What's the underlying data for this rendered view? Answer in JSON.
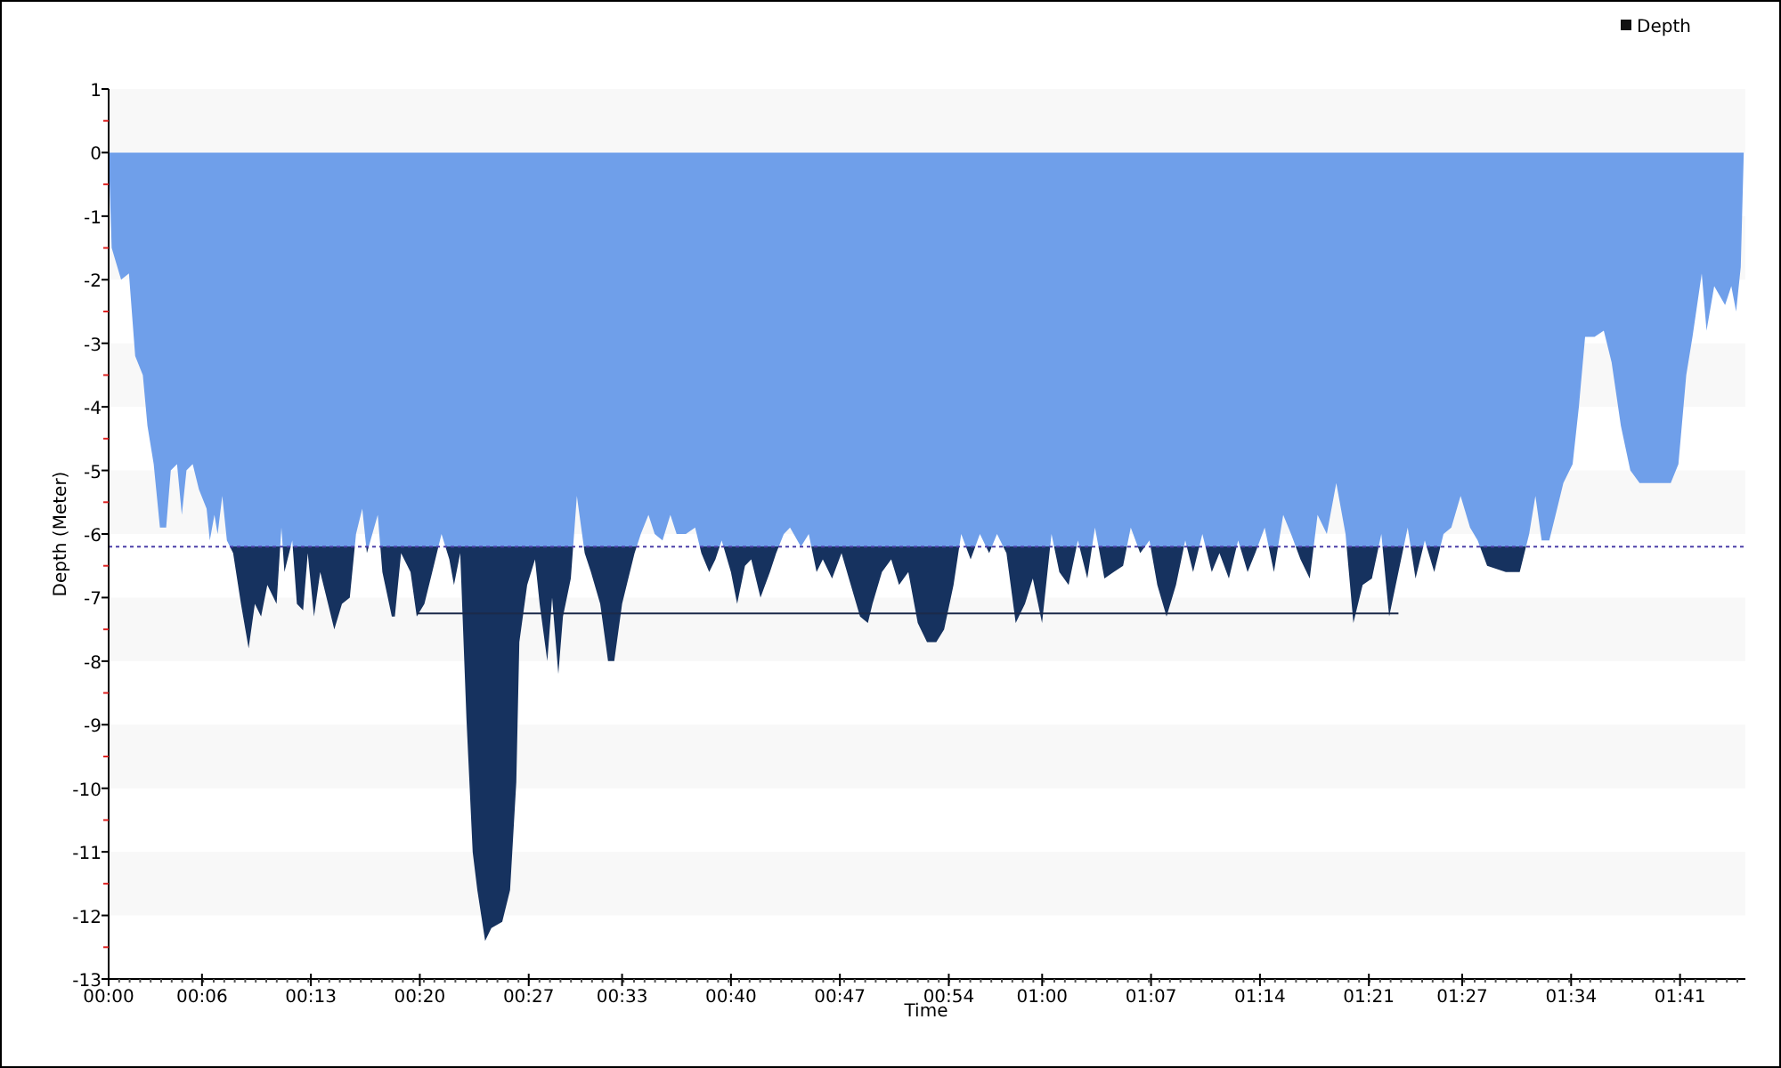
{
  "chart_data": {
    "type": "area",
    "xlabel": "Time",
    "ylabel": "Depth (Meter)",
    "xlim": [
      0,
      105.2
    ],
    "ylim": [
      -13,
      1
    ],
    "yticks": [
      1,
      0,
      -1,
      -2,
      -3,
      -4,
      -5,
      -6,
      -7,
      -8,
      -9,
      -10,
      -11,
      -12,
      -13
    ],
    "xticks": [
      {
        "value": 0,
        "label": "00:00"
      },
      {
        "value": 6,
        "label": "00:06"
      },
      {
        "value": 13,
        "label": "00:13"
      },
      {
        "value": 20,
        "label": "00:20"
      },
      {
        "value": 27,
        "label": "00:27"
      },
      {
        "value": 33,
        "label": "00:33"
      },
      {
        "value": 40,
        "label": "00:40"
      },
      {
        "value": 47,
        "label": "00:47"
      },
      {
        "value": 54,
        "label": "00:54"
      },
      {
        "value": 60,
        "label": "01:00"
      },
      {
        "value": 67,
        "label": "01:07"
      },
      {
        "value": 74,
        "label": "01:14"
      },
      {
        "value": 81,
        "label": "01:21"
      },
      {
        "value": 87,
        "label": "01:27"
      },
      {
        "value": 94,
        "label": "01:34"
      },
      {
        "value": 101,
        "label": "01:41"
      }
    ],
    "x": [
      0,
      0.2,
      0.8,
      1.3,
      1.7,
      2.2,
      2.5,
      2.9,
      3.3,
      3.7,
      4.0,
      4.4,
      4.7,
      5.0,
      5.4,
      5.8,
      6.3,
      6.5,
      6.8,
      7.0,
      7.3,
      7.6,
      8.0,
      8.5,
      9.0,
      9.4,
      9.8,
      10.2,
      10.8,
      11.1,
      11.3,
      11.8,
      12.1,
      12.5,
      12.8,
      13.2,
      13.6,
      14.1,
      14.5,
      15.0,
      15.5,
      15.9,
      16.3,
      16.6,
      17.3,
      17.6,
      18.2,
      18.4,
      18.8,
      19.4,
      19.8,
      20.3,
      20.8,
      21.4,
      21.9,
      22.2,
      22.6,
      23.0,
      23.4,
      23.7,
      24.2,
      24.6,
      25.3,
      25.8,
      26.2,
      26.4,
      26.9,
      27.4,
      27.7,
      28.2,
      28.5,
      28.9,
      29.2,
      29.7,
      30.1,
      30.6,
      31.0,
      31.6,
      32.1,
      32.5,
      33.0,
      33.3,
      33.8,
      34.2,
      34.7,
      35.1,
      35.6,
      36.1,
      36.5,
      37.1,
      37.7,
      38.1,
      38.6,
      39.0,
      39.4,
      40.0,
      40.4,
      40.9,
      41.3,
      41.9,
      42.5,
      42.9,
      43.4,
      43.8,
      44.5,
      45.0,
      45.5,
      45.9,
      46.5,
      47.1,
      47.7,
      48.3,
      48.8,
      49.1,
      49.7,
      50.3,
      50.8,
      51.4,
      52.0,
      52.6,
      53.2,
      53.7,
      54.3,
      54.8,
      55.4,
      56.0,
      56.6,
      57.1,
      57.7,
      58.3,
      58.9,
      59.4,
      60.0,
      60.6,
      61.1,
      61.7,
      62.3,
      62.9,
      63.4,
      64.0,
      64.6,
      65.2,
      65.7,
      66.3,
      66.9,
      67.4,
      68.0,
      68.6,
      69.2,
      69.7,
      70.3,
      70.9,
      71.4,
      72.0,
      72.6,
      73.2,
      73.7,
      74.3,
      74.9,
      75.5,
      76.0,
      76.6,
      77.2,
      77.7,
      78.3,
      78.9,
      79.5,
      80.0,
      80.6,
      81.2,
      81.8,
      82.3,
      82.9,
      83.5,
      84.0,
      84.6,
      85.2,
      85.8,
      86.3,
      86.9,
      87.5,
      88.0,
      88.6,
      89.8,
      90.7,
      91.3,
      91.7,
      92.1,
      92.6,
      93.1,
      93.5,
      94.1,
      94.5,
      94.9,
      95.5,
      96.1,
      96.6,
      97.2,
      97.8,
      98.4,
      99.5,
      100.4,
      100.9,
      101.4,
      101.8,
      102.4,
      102.7,
      103.2,
      103.9,
      104.3,
      104.6,
      104.9,
      105.1
    ],
    "series": [
      {
        "name": "Depth",
        "color": "#6f9fea",
        "values": [
          0,
          -1.5,
          -2.0,
          -1.9,
          -3.2,
          -3.5,
          -4.3,
          -4.9,
          -5.9,
          -5.9,
          -5.0,
          -4.9,
          -5.7,
          -5.0,
          -4.9,
          -5.3,
          -5.6,
          -6.1,
          -5.7,
          -6.0,
          -5.4,
          -6.1,
          -6.3,
          -7.1,
          -7.8,
          -7.1,
          -7.3,
          -6.8,
          -7.1,
          -5.9,
          -6.6,
          -6.1,
          -7.1,
          -7.2,
          -6.3,
          -7.3,
          -6.6,
          -7.1,
          -7.5,
          -7.1,
          -7.0,
          -6.0,
          -5.6,
          -6.3,
          -5.7,
          -6.6,
          -7.3,
          -7.3,
          -6.3,
          -6.6,
          -7.3,
          -7.1,
          -6.6,
          -6.0,
          -6.4,
          -6.8,
          -6.3,
          -8.9,
          -11.0,
          -11.6,
          -12.4,
          -12.2,
          -12.1,
          -11.6,
          -9.9,
          -7.7,
          -6.8,
          -6.4,
          -7.1,
          -8.0,
          -7.0,
          -8.2,
          -7.3,
          -6.7,
          -5.4,
          -6.3,
          -6.6,
          -7.1,
          -8.0,
          -8.0,
          -7.1,
          -6.8,
          -6.3,
          -6.0,
          -5.7,
          -6.0,
          -6.1,
          -5.7,
          -6.0,
          -6.0,
          -5.9,
          -6.3,
          -6.6,
          -6.4,
          -6.1,
          -6.6,
          -7.1,
          -6.5,
          -6.4,
          -7.0,
          -6.6,
          -6.3,
          -6.0,
          -5.9,
          -6.2,
          -6.0,
          -6.6,
          -6.4,
          -6.7,
          -6.3,
          -6.8,
          -7.3,
          -7.4,
          -7.1,
          -6.6,
          -6.4,
          -6.8,
          -6.6,
          -7.4,
          -7.7,
          -7.7,
          -7.5,
          -6.8,
          -6.0,
          -6.4,
          -6.0,
          -6.3,
          -6.0,
          -6.3,
          -7.4,
          -7.1,
          -6.7,
          -7.4,
          -6.0,
          -6.6,
          -6.8,
          -6.1,
          -6.7,
          -5.9,
          -6.7,
          -6.6,
          -6.5,
          -5.9,
          -6.3,
          -6.1,
          -6.8,
          -7.3,
          -6.8,
          -6.1,
          -6.6,
          -6.0,
          -6.6,
          -6.3,
          -6.7,
          -6.1,
          -6.6,
          -6.3,
          -5.9,
          -6.6,
          -5.7,
          -6.0,
          -6.4,
          -6.7,
          -5.7,
          -6.0,
          -5.2,
          -6.0,
          -7.4,
          -6.8,
          -6.7,
          -6.0,
          -7.3,
          -6.6,
          -5.9,
          -6.7,
          -6.1,
          -6.6,
          -6.0,
          -5.9,
          -5.4,
          -5.9,
          -6.1,
          -6.5,
          -6.6,
          -6.6,
          -6.0,
          -5.4,
          -6.1,
          -6.1,
          -5.6,
          -5.2,
          -4.9,
          -4.0,
          -2.9,
          -2.9,
          -2.8,
          -3.3,
          -4.3,
          -5.0,
          -5.2,
          -5.2,
          -5.2,
          -4.9,
          -3.5,
          -2.9,
          -1.9,
          -2.8,
          -2.1,
          -2.4,
          -2.1,
          -2.5,
          -1.8,
          0
        ]
      },
      {
        "type": "line",
        "color": "#1b2a4a",
        "values": [
          null,
          null,
          null,
          null,
          null,
          null,
          null,
          null,
          null,
          null,
          null,
          null,
          null,
          null,
          null,
          null,
          null,
          null,
          null,
          null,
          null,
          null,
          null,
          null,
          null,
          null,
          null,
          null,
          null,
          null,
          null,
          null,
          null,
          null,
          null,
          null,
          null,
          null,
          null,
          null,
          null,
          null,
          null,
          null,
          null,
          null,
          null,
          null,
          null,
          null,
          -7.25,
          -7.25,
          -7.25,
          -7.25,
          -7.25,
          -7.25,
          -7.25,
          -7.25,
          -7.25,
          -7.25,
          -7.25,
          -7.25,
          -7.25,
          -7.25,
          -7.25,
          -7.25,
          -7.25,
          -7.25,
          -7.25,
          -7.25,
          -7.25,
          -7.25,
          -7.25,
          -7.25,
          -7.25,
          -7.25,
          -7.25,
          -7.25,
          -7.25,
          -7.25,
          -7.25,
          -7.25,
          -7.25,
          -7.25,
          -7.25,
          -7.25,
          -7.25,
          -7.25,
          -7.25,
          -7.25,
          -7.25,
          -7.25,
          -7.25,
          -7.25,
          -7.25,
          -7.25,
          -7.25,
          -7.25,
          -7.25,
          -7.25,
          -7.25,
          -7.25,
          -7.25,
          -7.25,
          -7.25,
          -7.25,
          -7.25,
          -7.25,
          -7.25,
          -7.25,
          -7.25,
          -7.25,
          -7.25,
          -7.25,
          -7.25,
          -7.25,
          -7.25,
          -7.25,
          -7.25,
          -7.25,
          -7.25,
          -7.25,
          -7.25,
          -7.25,
          -7.25,
          -7.25,
          -7.25,
          -7.25,
          -7.25,
          -7.25,
          -7.25,
          -7.25,
          -7.25,
          -7.25,
          -7.25,
          -7.25,
          -7.25,
          -7.25,
          -7.25,
          -7.25,
          -7.25,
          -7.25,
          -7.25,
          -7.25,
          -7.25,
          -7.25,
          -7.25,
          -7.25,
          -7.25,
          -7.25,
          -7.25,
          -7.25,
          -7.25,
          -7.25,
          -7.25,
          -7.25,
          -7.25,
          -7.25,
          -7.25,
          -7.25,
          -7.25,
          -7.25,
          -7.25,
          -7.25,
          -7.25,
          -7.25,
          -7.25,
          -7.25,
          -7.25,
          -7.25,
          -7.25,
          -7.25,
          -7.25,
          null,
          null,
          null,
          null,
          null,
          null,
          null,
          null,
          null,
          null,
          null,
          null,
          null,
          null,
          null,
          null,
          null,
          null,
          null,
          null,
          null,
          null,
          null,
          null,
          null,
          null,
          null,
          null,
          null,
          null,
          null,
          null,
          null,
          null,
          null,
          null,
          null,
          null,
          null,
          null
        ]
      }
    ],
    "ref_lines": [
      {
        "axis": "y",
        "value": -6.2
      }
    ]
  }
}
